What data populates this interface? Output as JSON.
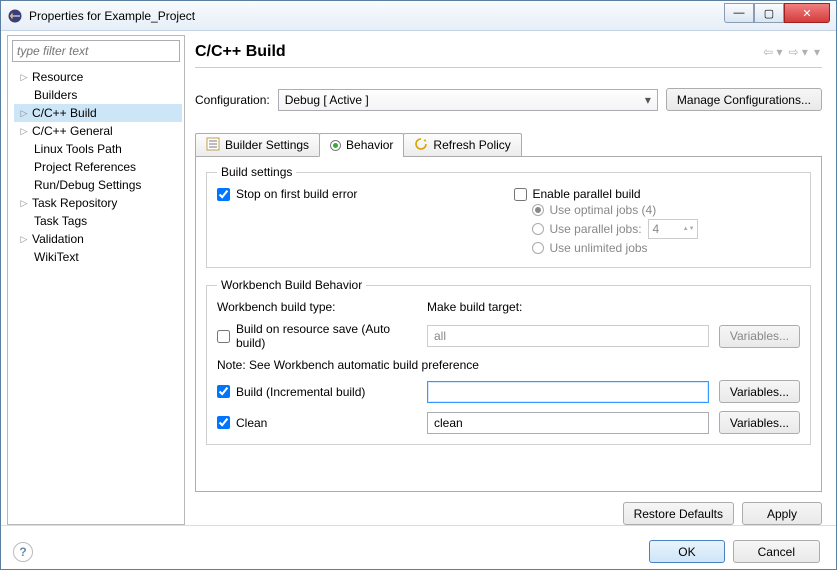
{
  "window": {
    "title": "Properties for Example_Project"
  },
  "filter": {
    "placeholder": "type filter text"
  },
  "tree": {
    "items": [
      {
        "label": "Resource",
        "expandable": true
      },
      {
        "label": "Builders",
        "expandable": false
      },
      {
        "label": "C/C++ Build",
        "expandable": true,
        "selected": true
      },
      {
        "label": "C/C++ General",
        "expandable": true
      },
      {
        "label": "Linux Tools Path",
        "expandable": false
      },
      {
        "label": "Project References",
        "expandable": false
      },
      {
        "label": "Run/Debug Settings",
        "expandable": false
      },
      {
        "label": "Task Repository",
        "expandable": true
      },
      {
        "label": "Task Tags",
        "expandable": false
      },
      {
        "label": "Validation",
        "expandable": true
      },
      {
        "label": "WikiText",
        "expandable": false
      }
    ]
  },
  "header": {
    "title": "C/C++ Build"
  },
  "config": {
    "label": "Configuration:",
    "value": "Debug  [ Active ]",
    "manage_btn": "Manage Configurations..."
  },
  "tabs": {
    "builder": "Builder Settings",
    "behavior": "Behavior",
    "refresh": "Refresh Policy"
  },
  "build_settings": {
    "legend": "Build settings",
    "stop_on_error": "Stop on first build error",
    "enable_parallel": "Enable parallel build",
    "optimal_jobs": "Use optimal jobs (4)",
    "parallel_jobs": "Use parallel jobs:",
    "parallel_value": "4",
    "unlimited": "Use unlimited jobs"
  },
  "workbench": {
    "legend": "Workbench Build Behavior",
    "type_label": "Workbench build type:",
    "target_label": "Make build target:",
    "auto_build": "Build on resource save (Auto build)",
    "auto_value": "all",
    "note": "Note: See Workbench automatic build preference",
    "incremental": "Build (Incremental build)",
    "incremental_value": "",
    "clean": "Clean",
    "clean_value": "clean",
    "variables_btn": "Variables..."
  },
  "buttons": {
    "restore": "Restore Defaults",
    "apply": "Apply",
    "ok": "OK",
    "cancel": "Cancel"
  }
}
